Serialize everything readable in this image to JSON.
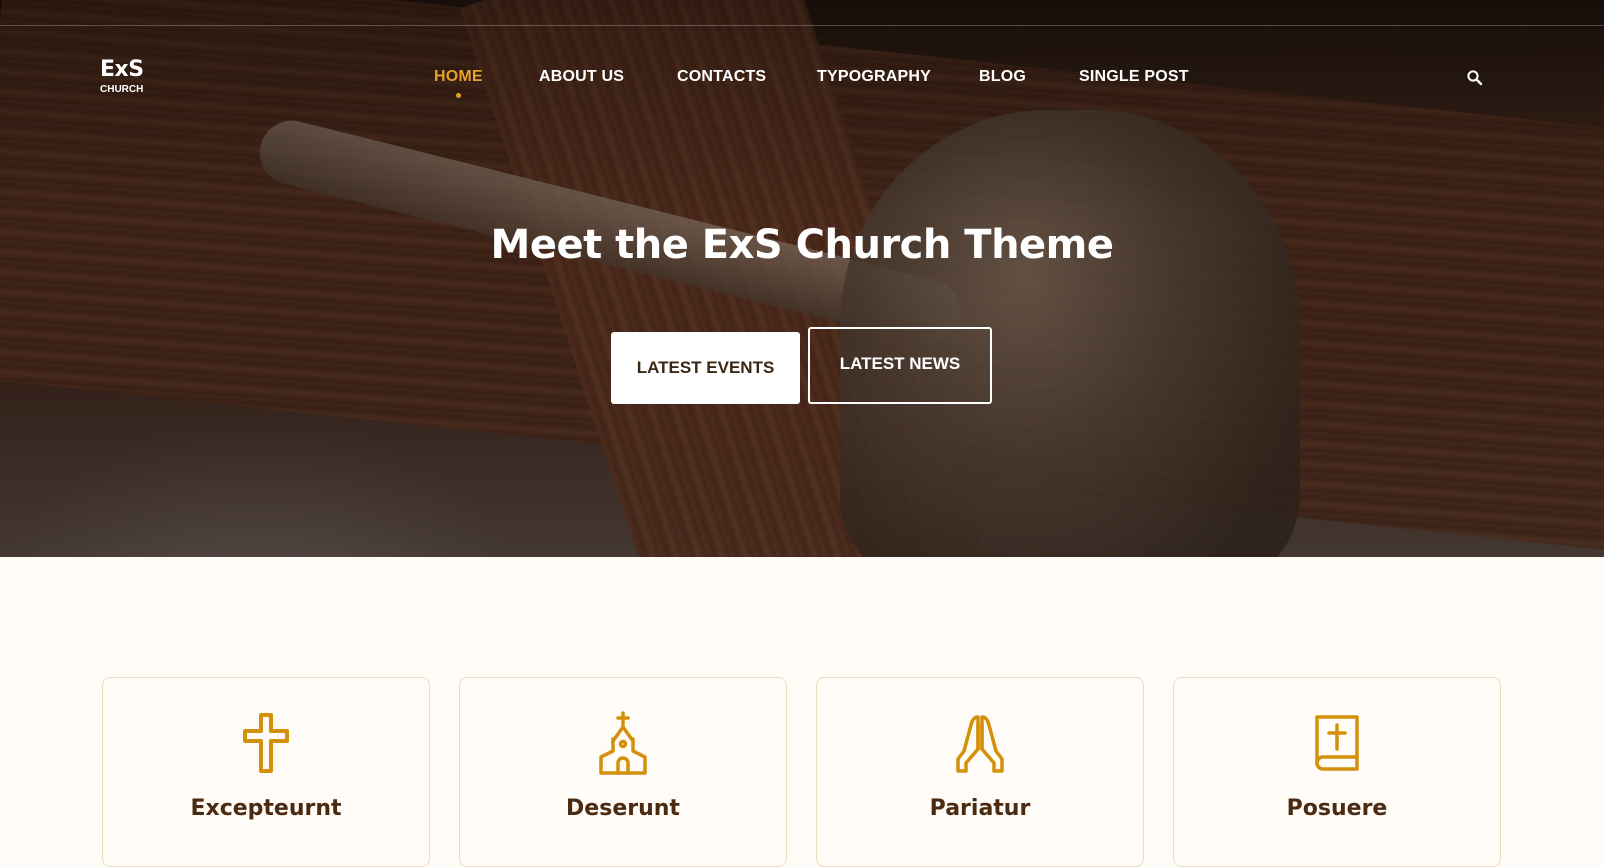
{
  "brand": {
    "name": "ExS",
    "tagline": "CHURCH"
  },
  "nav": {
    "items": [
      {
        "label": "HOME",
        "active": true
      },
      {
        "label": "ABOUT US",
        "active": false
      },
      {
        "label": "CONTACTS",
        "active": false
      },
      {
        "label": "TYPOGRAPHY",
        "active": false
      },
      {
        "label": "BLOG",
        "active": false
      },
      {
        "label": "SINGLE POST",
        "active": false
      }
    ],
    "search_icon": "search-icon"
  },
  "hero": {
    "title": "Meet the ExS Church Theme",
    "primary_button": "LATEST EVENTS",
    "secondary_button": "LATEST NEWS",
    "background": "crucifix-photo"
  },
  "features": [
    {
      "icon": "cross-icon",
      "title": "Excepteurnt"
    },
    {
      "icon": "church-icon",
      "title": "Deserunt"
    },
    {
      "icon": "praying-hands-icon",
      "title": "Pariatur"
    },
    {
      "icon": "bible-icon",
      "title": "Posuere"
    }
  ],
  "colors": {
    "accent": "#e8a02c",
    "icon": "#d4900a",
    "heading": "#4a2a10",
    "page_background": "#fffcf7",
    "card_border": "#ecdcc4"
  }
}
